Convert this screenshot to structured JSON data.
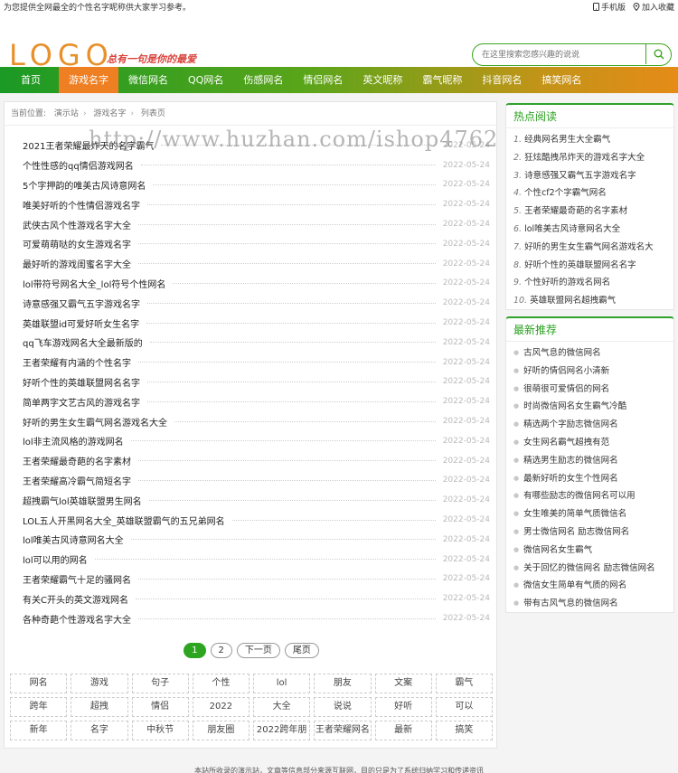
{
  "topbar": {
    "notice": "为您提供全网最全的个性名字昵称供大家学习参考。",
    "mobile": "手机版",
    "favorite": "加入收藏"
  },
  "header": {
    "logo": "LOGO",
    "slogan": "总有一句是你的最爱",
    "search_placeholder": "在这里搜索您感兴趣的说说"
  },
  "nav": [
    "首页",
    "游戏名字",
    "微信网名",
    "QQ网名",
    "伤感网名",
    "情侣网名",
    "英文昵称",
    "霸气昵称",
    "抖音网名",
    "搞笑网名"
  ],
  "breadcrumb": [
    "当前位置:",
    "演示站",
    "游戏名字",
    "列表页"
  ],
  "articles": [
    {
      "title": "2021王者荣耀最炸天的名字霸气",
      "date": "2022-05-24"
    },
    {
      "title": "个性性感的qq情侣游戏网名",
      "date": "2022-05-24"
    },
    {
      "title": "5个字押韵的唯美古风诗意网名",
      "date": "2022-05-24"
    },
    {
      "title": "唯美好听的个性情侣游戏名字",
      "date": "2022-05-24"
    },
    {
      "title": "武侠古风个性游戏名字大全",
      "date": "2022-05-24"
    },
    {
      "title": "可爱萌萌哒的女生游戏名字",
      "date": "2022-05-24"
    },
    {
      "title": "最好听的游戏闺蜜名字大全",
      "date": "2022-05-24"
    },
    {
      "title": "lol带符号网名大全_lol符号个性网名",
      "date": "2022-05-24"
    },
    {
      "title": "诗意感强又霸气五字游戏名字",
      "date": "2022-05-24"
    },
    {
      "title": "英雄联盟id可爱好听女生名字",
      "date": "2022-05-24"
    },
    {
      "title": "qq飞车游戏网名大全最新版的",
      "date": "2022-05-24"
    },
    {
      "title": "王者荣耀有内涵的个性名字",
      "date": "2022-05-24"
    },
    {
      "title": "好听个性的英雄联盟网名名字",
      "date": "2022-05-24"
    },
    {
      "title": "简单两字文艺古风的游戏名字",
      "date": "2022-05-24"
    },
    {
      "title": "好听的男生女生霸气网名游戏名大全",
      "date": "2022-05-24"
    },
    {
      "title": "lol非主流风格的游戏网名",
      "date": "2022-05-24"
    },
    {
      "title": "王者荣耀最奇葩的名字素材",
      "date": "2022-05-24"
    },
    {
      "title": "王者荣耀高冷霸气简短名字",
      "date": "2022-05-24"
    },
    {
      "title": "超拽霸气lol英雄联盟男生网名",
      "date": "2022-05-24"
    },
    {
      "title": "LOL五人开黑网名大全_英雄联盟霸气的五兄弟网名",
      "date": "2022-05-24"
    },
    {
      "title": "lol唯美古风诗意网名大全",
      "date": "2022-05-24"
    },
    {
      "title": "lol可以用的网名",
      "date": "2022-05-24"
    },
    {
      "title": "王者荣耀霸气十足的骚网名",
      "date": "2022-05-24"
    },
    {
      "title": "有关C开头的英文游戏网名",
      "date": "2022-05-24"
    },
    {
      "title": "各种奇葩个性游戏名字大全",
      "date": "2022-05-24"
    }
  ],
  "pagination": {
    "pages": [
      "1",
      "2"
    ],
    "next": "下一页",
    "last": "尾页"
  },
  "tags": [
    "网名",
    "游戏",
    "句子",
    "个性",
    "lol",
    "朋友",
    "文案",
    "霸气",
    "跨年",
    "超拽",
    "情侣",
    "2022",
    "大全",
    "说说",
    "好听",
    "可以",
    "新年",
    "名字",
    "中秋节",
    "朋友圈",
    "2022跨年朋",
    "王者荣耀网名",
    "最新",
    "搞笑"
  ],
  "hot": {
    "title": "热点阅读",
    "items": [
      "经典网名男生大全霸气",
      "狂炫酷拽吊炸天的游戏名字大全",
      "诗意感强又霸气五字游戏名字",
      "个性cf2个字霸气网名",
      "王者荣耀最奇葩的名字素材",
      "lol唯美古风诗意网名大全",
      "好听的男生女生霸气网名游戏名大",
      "好听个性的英雄联盟网名名字",
      "个性好听的游戏名网名",
      "英雄联盟网名超拽霸气"
    ]
  },
  "recommend": {
    "title": "最新推荐",
    "items": [
      "古风气息的微信网名",
      "好听的情侣网名小清新",
      "很萌很可爱情侣的网名",
      "时尚微信网名女生霸气冷酷",
      "精选两个字励志微信网名",
      "女生网名霸气超拽有范",
      "精选男生励志的微信网名",
      "最新好听的女生个性网名",
      "有哪些励志的微信网名可以用",
      "女生唯美的简单气质微信名",
      "男士微信网名 励志微信网名",
      "微信网名女生霸气",
      "关于回忆的微信网名 励志微信网名",
      "微信女生简单有气质的网名",
      "带有古风气息的微信网名"
    ]
  },
  "watermark": "http://www.huzhan.com/ishop4762",
  "footer": "本站所收录的演示站，文章等信息部分来源互联网，目的只是为了系统归纳学习和传递资讯"
}
